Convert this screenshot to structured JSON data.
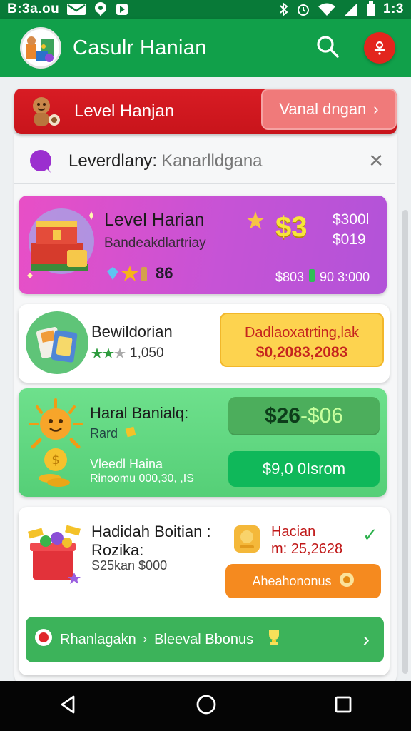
{
  "status_bar": {
    "time_label": "B:3a.ou",
    "clock": "1:3",
    "colors": {
      "bar": "#087a38"
    }
  },
  "app_bar": {
    "title": "Casulr Hanian",
    "colors": {
      "bar": "#11a04a",
      "notification": "#e3251d"
    }
  },
  "banner": {
    "title": "Level Hanjan",
    "button_label": "Vanal dngan"
  },
  "search": {
    "label": "Leverdlany:",
    "value": "Kanarlldgana"
  },
  "card_level": {
    "title": "Level Harian",
    "subtitle": "Bandeakdlartriay",
    "level": "86",
    "big_value": "$3",
    "amount_top": "$300l",
    "amount_bottom": "$019",
    "footer_left": "$803",
    "footer_right": "90 3:000"
  },
  "card_bonus": {
    "title": "Bewildorian",
    "rating": "1,050",
    "cta_line1": "Dadlaoxatrting,lak",
    "cta_line2": "$0,2083,2083"
  },
  "card_daily": {
    "title": "Haral Banialq:",
    "subtitle": "Rard",
    "price_main": "$26",
    "price_alt": "-$06",
    "sub_line1": "Vleedl Haina",
    "sub_line2": "Rinoomu   000,30, ,IS",
    "button_label": "$9,0 0Isrom"
  },
  "card_gift": {
    "title": "Hadidah Boitian :",
    "subtitle": "Rozika:",
    "amount": "S25kan $000",
    "info_title": "Hacian",
    "info_value": "m: 25,2628",
    "button_label": "Aheahononus",
    "bar_left": "Rhanlagakn",
    "bar_right": "Bleeval Bbonus"
  }
}
